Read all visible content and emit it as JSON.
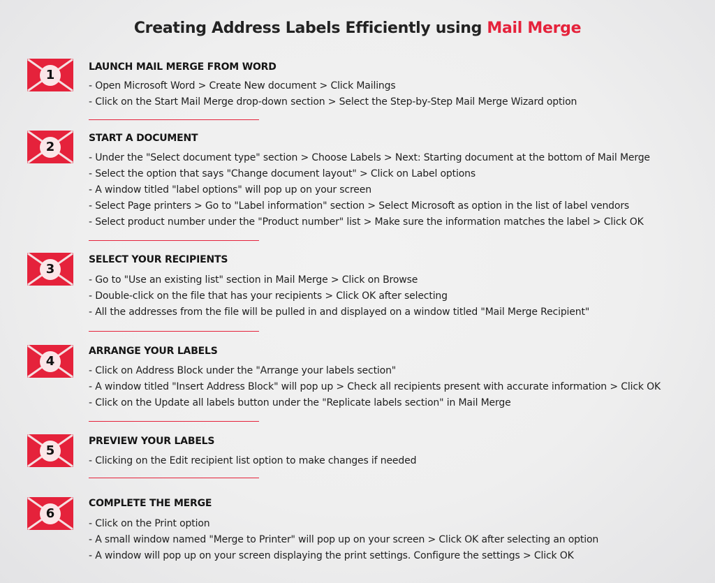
{
  "title": {
    "main": "Creating Address Labels Efficiently using ",
    "accent": "Mail Merge"
  },
  "colors": {
    "accent": "#e5223b",
    "text": "#1c1c1c"
  },
  "icon_semantic": "envelope-icon",
  "steps": [
    {
      "number": "1",
      "heading": "LAUNCH MAIL MERGE FROM WORD",
      "lines": [
        "- Open Microsoft Word > Create New document > Click Mailings",
        "- Click on the Start Mail Merge drop-down section > Select the Step-by-Step Mail Merge Wizard option"
      ]
    },
    {
      "number": "2",
      "heading": "START A DOCUMENT",
      "lines": [
        "- Under the \"Select document type\" section > Choose Labels > Next: Starting document at the bottom of Mail Merge",
        "- Select the option that says \"Change document layout\" > Click on Label options",
        "- A window titled \"label options\" will pop up on your screen",
        "- Select Page printers > Go to \"Label information\" section > Select Microsoft as option in the list of label vendors",
        "- Select product number under the \"Product number\" list > Make sure the information matches the label > Click OK"
      ]
    },
    {
      "number": "3",
      "heading": "SELECT YOUR RECIPIENTS",
      "lines": [
        "- Go to \"Use an existing list\" section in Mail Merge > Click on Browse",
        "- Double-click on the file that has your recipients > Click OK after selecting",
        "- All the addresses from the file will be pulled in and displayed on a window titled \"Mail Merge Recipient\""
      ]
    },
    {
      "number": "4",
      "heading": "ARRANGE YOUR LABELS",
      "lines": [
        "- Click on Address Block under the \"Arrange your labels section\"",
        "- A window titled \"Insert Address Block\" will pop up > Check all recipients present with accurate information > Click OK",
        "- Click on the Update all labels button under the \"Replicate labels section\" in Mail Merge"
      ]
    },
    {
      "number": "5",
      "heading": "PREVIEW YOUR LABELS",
      "lines": [
        "- Clicking on the Edit recipient list option to make changes if needed"
      ]
    },
    {
      "number": "6",
      "heading": "COMPLETE THE MERGE",
      "lines": [
        "- Click on the Print option",
        "- A small window named \"Merge to Printer\" will pop up on your screen > Click OK after selecting an option",
        "- A window will pop up on your screen displaying the print settings. Configure the settings > Click OK"
      ]
    }
  ]
}
